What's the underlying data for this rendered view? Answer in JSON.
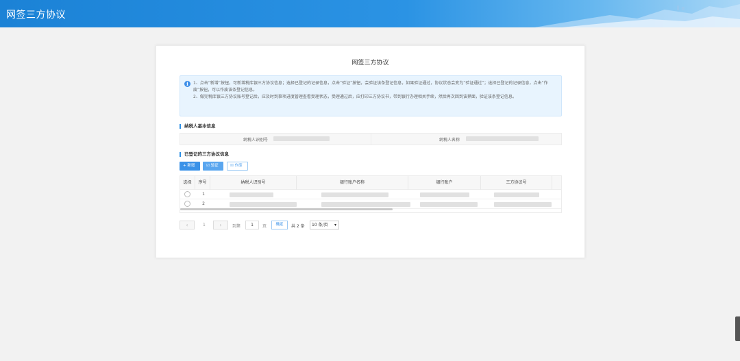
{
  "header": {
    "title": "网签三方协议"
  },
  "card": {
    "title": "网签三方协议"
  },
  "notice": {
    "line1": "1、点击“新增”按钮，可新增税库银三方协议信息；选择已登记的记录信息，点击“验证”按钮，会验证该条登记信息，如果验证通过，协议状态会变为“验证通过”；选择已登记的记录信息，点击“作废”按钮，可以作废该条登记信息。",
    "line2": "2、做完税库银三方协议账号登记后，应及时到事项进度管理查看受理状态，受理通过后，应打印三方协议书，带到银行办理相关手续，然后再次回到该界面，验证该条登记信息。"
  },
  "taxpayer": {
    "section_title": "纳税人基本信息",
    "id_label": "纳税人识别号",
    "name_label": "纳税人名称"
  },
  "agreements": {
    "section_title": "已登记的三方协议信息",
    "btn_new": "+ 新增",
    "btn_verify": "☑ 验证",
    "btn_void": "☒ 作废",
    "columns": [
      "选择",
      "序号",
      "纳税人识别号",
      "银行账户名称",
      "银行账户",
      "三方协议号"
    ],
    "rows": [
      {
        "no": "1"
      },
      {
        "no": "2"
      }
    ]
  },
  "pager": {
    "current": "1",
    "goto_label": "到第",
    "goto_value": "1",
    "page_unit": "页",
    "confirm": "确定",
    "total": "共 2 条",
    "page_size": "10 条/页"
  }
}
